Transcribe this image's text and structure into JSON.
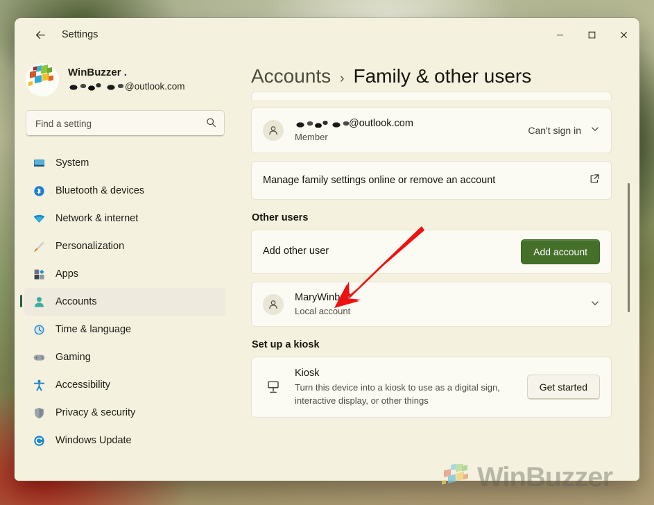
{
  "window": {
    "title": "Settings",
    "back_icon": "arrow-left-icon",
    "controls": {
      "minimize": "–",
      "maximize": "□",
      "close": "✕"
    }
  },
  "sidebar": {
    "account": {
      "name": "WinBuzzer .",
      "email_suffix": "@outlook.com",
      "email_redacted": true,
      "avatar_icon": "winbuzzer-cubes-avatar"
    },
    "search": {
      "placeholder": "Find a setting",
      "value": "",
      "icon": "search-icon"
    },
    "items": [
      {
        "label": "System",
        "icon": "monitor-icon",
        "selected": false
      },
      {
        "label": "Bluetooth & devices",
        "icon": "bluetooth-icon",
        "selected": false
      },
      {
        "label": "Network & internet",
        "icon": "wifi-icon",
        "selected": false
      },
      {
        "label": "Personalization",
        "icon": "paintbrush-icon",
        "selected": false
      },
      {
        "label": "Apps",
        "icon": "apps-grid-icon",
        "selected": false
      },
      {
        "label": "Accounts",
        "icon": "person-icon",
        "selected": true
      },
      {
        "label": "Time & language",
        "icon": "clock-globe-icon",
        "selected": false
      },
      {
        "label": "Gaming",
        "icon": "gamepad-icon",
        "selected": false
      },
      {
        "label": "Accessibility",
        "icon": "accessibility-person-icon",
        "selected": false
      },
      {
        "label": "Privacy & security",
        "icon": "shield-icon",
        "selected": false
      },
      {
        "label": "Windows Update",
        "icon": "update-refresh-icon",
        "selected": false
      }
    ]
  },
  "main": {
    "breadcrumb": {
      "parent": "Accounts",
      "separator": "›",
      "current": "Family & other users"
    },
    "family_member": {
      "email_suffix": "@outlook.com",
      "email_redacted": true,
      "role": "Member",
      "status": "Can't sign in",
      "avatar_icon": "person-icon",
      "chevron_icon": "chevron-down-icon"
    },
    "manage_family_link": {
      "label": "Manage family settings online or remove an account",
      "icon": "external-link-icon"
    },
    "other_users": {
      "heading": "Other users",
      "add_other_user": {
        "label": "Add other user",
        "button_label": "Add account",
        "button_color": "#44702a"
      },
      "accounts": [
        {
          "name": "MaryWinbu2",
          "type": "Local account",
          "avatar_icon": "person-icon",
          "chevron_icon": "chevron-down-icon"
        }
      ]
    },
    "kiosk": {
      "heading": "Set up a kiosk",
      "title": "Kiosk",
      "description": "Turn this device into a kiosk to use as a digital sign, interactive display, or other things",
      "button_label": "Get started",
      "icon": "kiosk-sign-icon"
    },
    "scrollbar": {
      "visible": true
    }
  },
  "annotation": {
    "type": "arrow",
    "color": "#ef1111",
    "points_to": "MaryWinbu2 local account row"
  },
  "watermark": {
    "text": "WinBuzzer",
    "logo_icon": "winbuzzer-cubes-logo"
  }
}
